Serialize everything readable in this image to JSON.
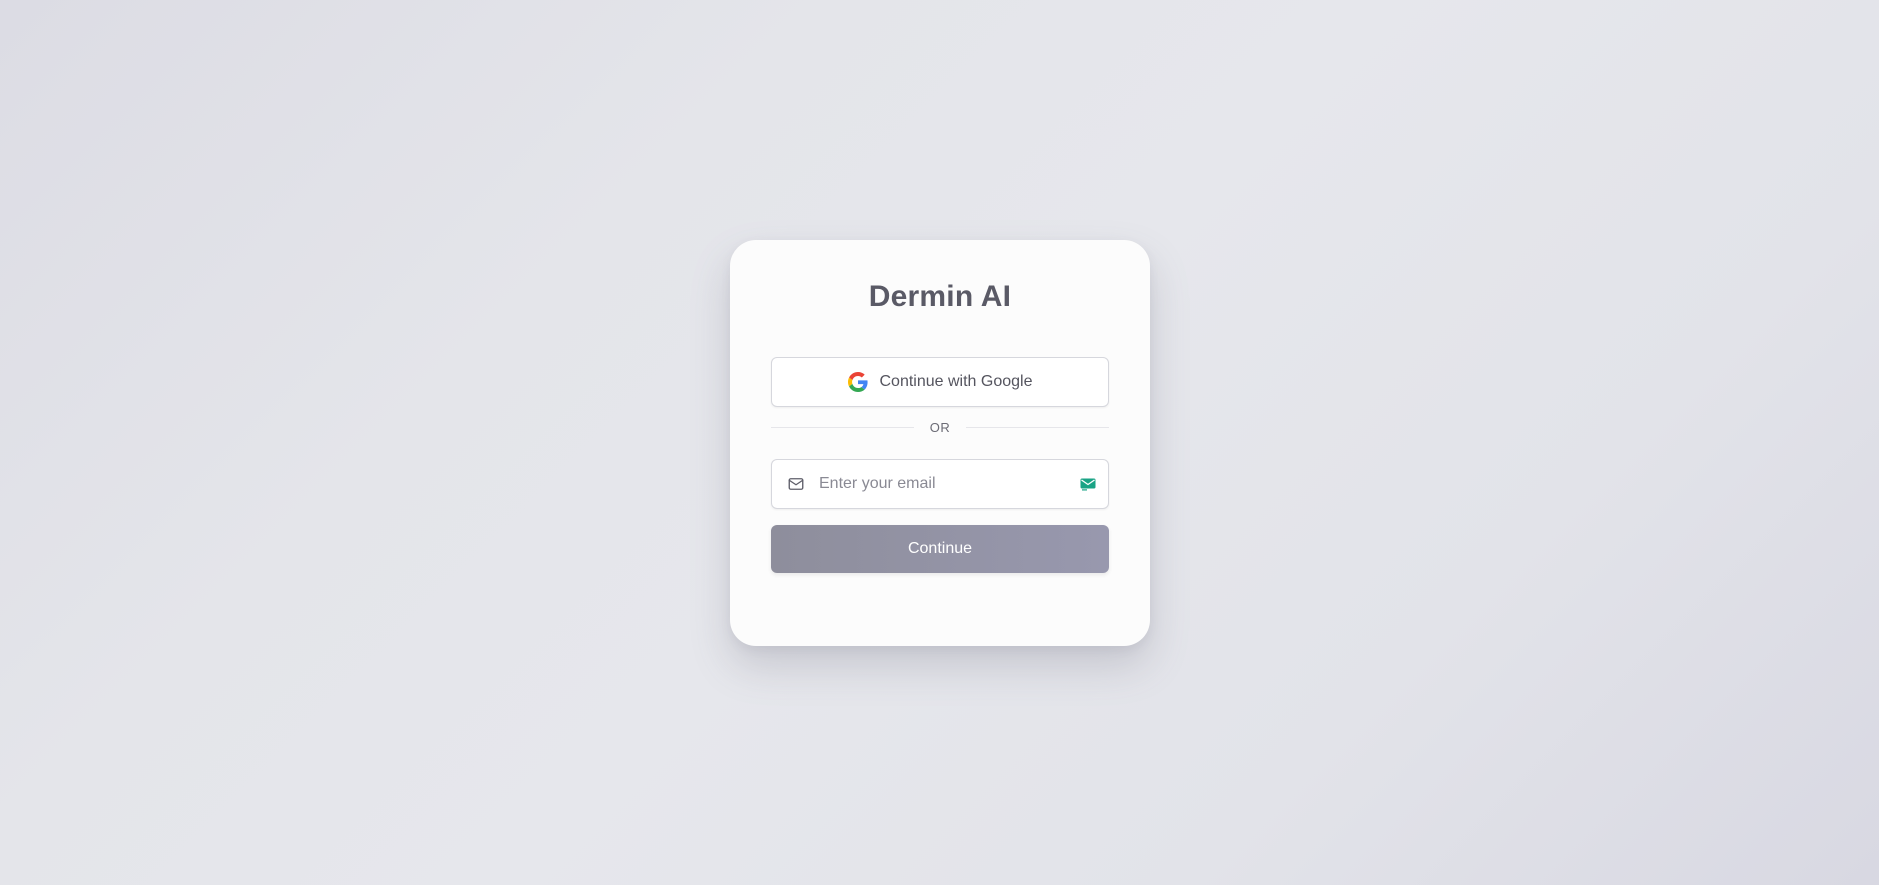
{
  "app": {
    "title": "Dermin AI"
  },
  "google_button": {
    "label": "Continue with Google",
    "icon": "google-g-icon"
  },
  "divider": {
    "label": "OR"
  },
  "email": {
    "placeholder": "Enter your email",
    "value": "",
    "icon": "mail-icon",
    "autofill_icon": "email-autofill-icon"
  },
  "continue_button": {
    "label": "Continue"
  },
  "colors": {
    "title": "#5a5a66",
    "continue_button": "#9494a6",
    "card_background": "#fcfcfc"
  }
}
